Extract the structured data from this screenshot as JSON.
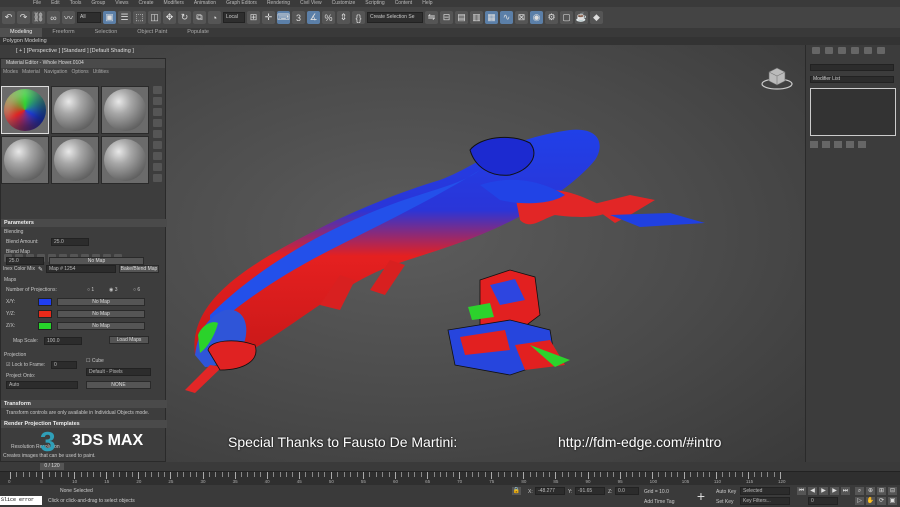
{
  "menu": [
    "File",
    "Edit",
    "Tools",
    "Group",
    "Views",
    "Create",
    "Modifiers",
    "Animation",
    "Graph Editors",
    "Rendering",
    "Civil View",
    "Customize",
    "Scripting",
    "Content",
    "Help"
  ],
  "toolbar": {
    "filter_value": "All",
    "coord_value": "Local",
    "selection_set": "Create Selection Se"
  },
  "ribbon": {
    "tabs": [
      "Modeling",
      "Freeform",
      "Selection",
      "Object Paint",
      "Populate"
    ],
    "active": "Modeling",
    "sub_label": "Polygon Modeling"
  },
  "viewport": {
    "label": "[ + ] [Perspective ] [Standard ] [Default Shading ]"
  },
  "material_editor": {
    "title": "Material Editor - Whole Hover.0104",
    "menu": [
      "Modes",
      "Material",
      "Navigation",
      "Options",
      "Utilities"
    ],
    "material_type": "Inex Color Mix",
    "map_name": "Map # 1254",
    "bake_button": "Bake/Blend Map",
    "parameters_title": "Parameters",
    "blending_label": "Blending",
    "blend_amount_label": "Blend Amount:",
    "blend_amount_value": "25.0",
    "blend_map_label": "Blend Map",
    "blend_map_value": "25.0",
    "no_map": "No Map",
    "maps_label": "Maps",
    "num_projections_label": "Number of Projections:",
    "projection_options": [
      "1",
      "3",
      "6"
    ],
    "axes": [
      {
        "label": "X/Y:",
        "color": "#1f3ef0"
      },
      {
        "label": "Y/Z:",
        "color": "#e82a1a"
      },
      {
        "label": "Z/X:",
        "color": "#26d32a"
      }
    ],
    "load_maps": "Load Maps",
    "map_scale_label": "Map Scale:",
    "map_scale_value": "100.0",
    "projection_label": "Projection",
    "lock_to_frame_label": "Lock to Frame:",
    "lock_to_frame_value": "0",
    "cube_label": "Cube",
    "project_onto_label": "Project Onto:",
    "project_onto_value": "Auto",
    "cube_value": "Default - Pixels",
    "none_button": "NONE",
    "transform_title": "Transform",
    "transform_note": "Transform controls are only available in Individual Objects mode.",
    "render_title": "Render Projection Templates",
    "resolution_label": "Resolution Resolution",
    "create_note": "Creates images that can be used to paint."
  },
  "overlay": {
    "logo_number": "3",
    "logo_text": "3DS MAX",
    "thanks": "Special Thanks to Fausto De Martini:",
    "url": "http://fdm-edge.com/#intro"
  },
  "right_panel": {
    "modifier_list": "Modifier List"
  },
  "timeline": {
    "frame_label": "0 / 120",
    "tick_labels": [
      "0",
      "5",
      "10",
      "15",
      "20",
      "25",
      "30",
      "35",
      "40",
      "45",
      "50",
      "55",
      "60",
      "65",
      "70",
      "75",
      "80",
      "85",
      "90",
      "95",
      "100",
      "105",
      "110",
      "115",
      "120"
    ]
  },
  "status": {
    "maxscript": "Slice error",
    "selection": "None Selected",
    "prompt": "Click or click-and-drag to select objects",
    "x_label": "X:",
    "x_value": "-48.277",
    "y_label": "Y:",
    "y_value": "-91.65",
    "z_label": "Z:",
    "z_value": "0.0",
    "grid": "Grid = 10.0",
    "add_time_tag": "Add Time Tag",
    "auto_key": "Auto Key",
    "set_key": "Set Key",
    "selected_value": "Selected",
    "key_filters": "Key Filters...",
    "frame_value": "0"
  },
  "colors": {
    "projection_blue": "#1f3ef0",
    "projection_red": "#e82a1a",
    "projection_green": "#26d32a",
    "logo_accent": "#2f9fb8"
  }
}
